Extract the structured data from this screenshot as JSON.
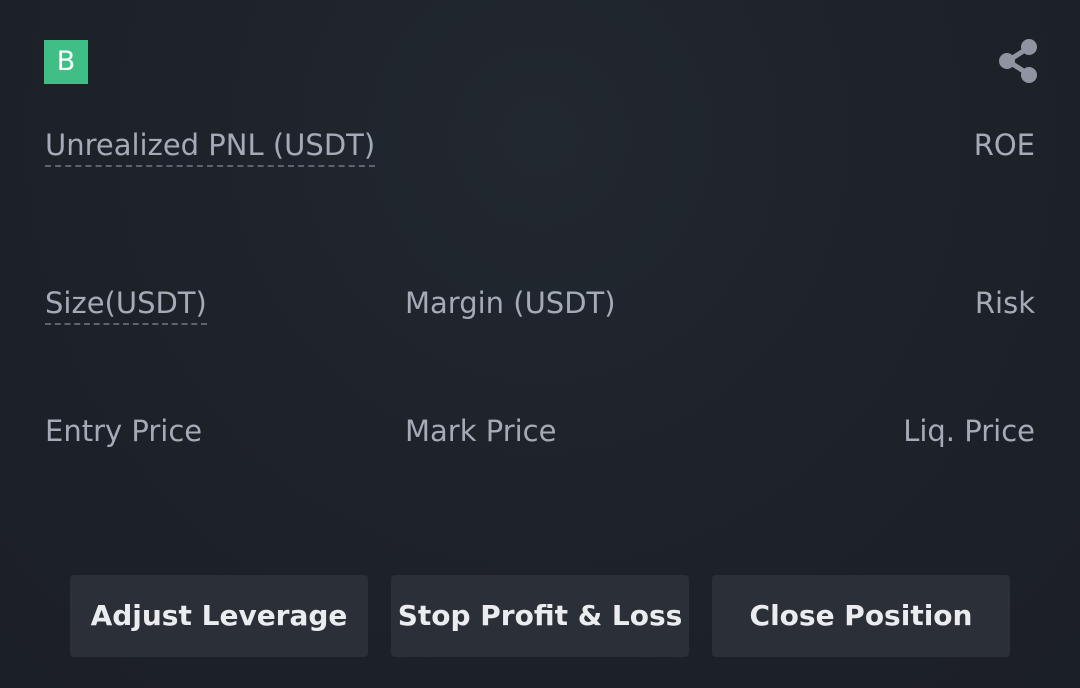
{
  "header": {
    "badge_letter": "B",
    "badge_color": "#3fbf86",
    "share_icon": "share-icon"
  },
  "fields": {
    "unrealized_pnl_label": "Unrealized PNL (USDT)",
    "roe_label": "ROE",
    "size_label": "Size(USDT)",
    "margin_label": "Margin (USDT)",
    "risk_label": "Risk",
    "entry_price_label": "Entry Price",
    "mark_price_label": "Mark Price",
    "liq_price_label": "Liq. Price"
  },
  "actions": {
    "adjust_leverage": "Adjust Leverage",
    "stop_profit_loss": "Stop Profit & Loss",
    "close_position": "Close Position"
  }
}
